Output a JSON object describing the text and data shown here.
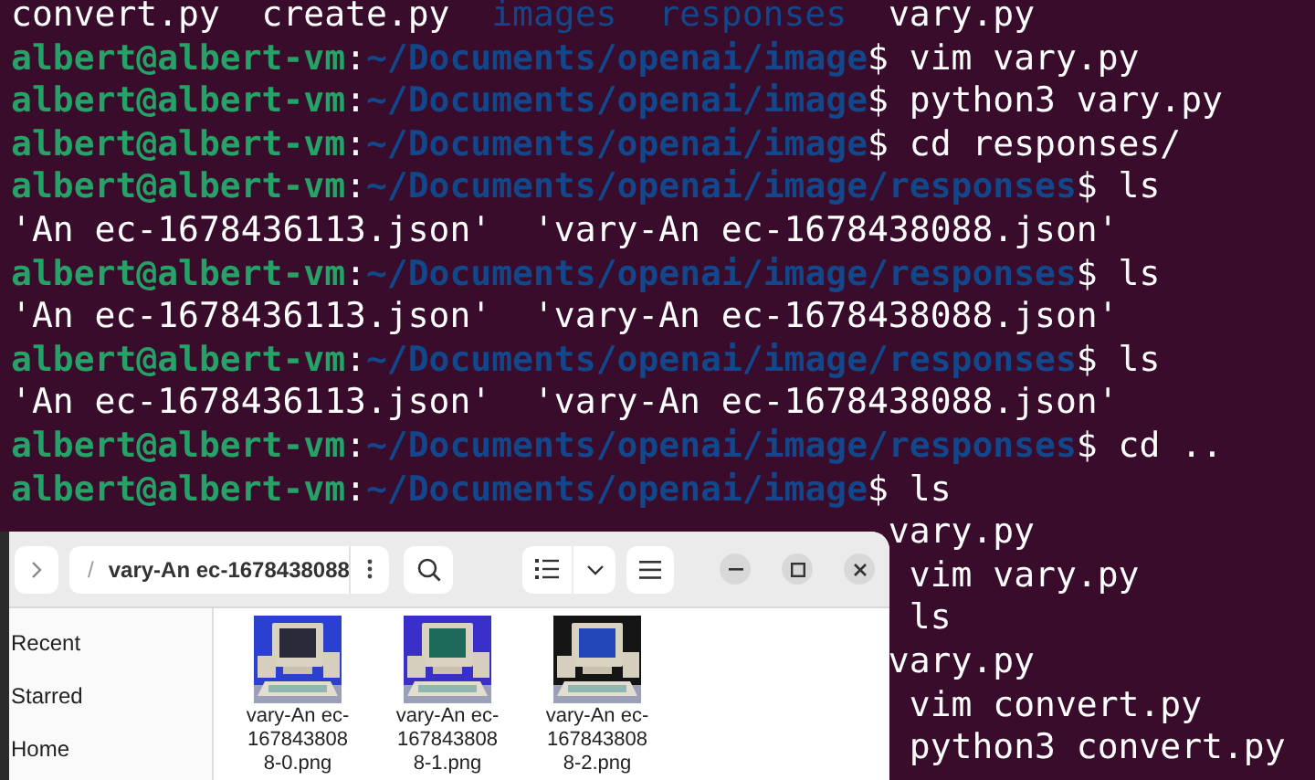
{
  "terminal": {
    "lines": [
      {
        "parts": [
          {
            "kind": "plain",
            "text": "convert.py  create.py"
          },
          {
            "kind": "dir",
            "text": "  images"
          },
          {
            "kind": "dir",
            "text": "  responses"
          },
          {
            "kind": "plain",
            "text": "  vary.py"
          }
        ]
      },
      {
        "parts": [
          {
            "kind": "user",
            "text": "albert@albert-vm"
          },
          {
            "kind": "plain",
            "text": ":"
          },
          {
            "kind": "path",
            "text": "~/Documents/openai/image"
          },
          {
            "kind": "plain",
            "text": "$ vim vary.py"
          }
        ]
      },
      {
        "parts": [
          {
            "kind": "user",
            "text": "albert@albert-vm"
          },
          {
            "kind": "plain",
            "text": ":"
          },
          {
            "kind": "path",
            "text": "~/Documents/openai/image"
          },
          {
            "kind": "plain",
            "text": "$ python3 vary.py"
          }
        ]
      },
      {
        "parts": [
          {
            "kind": "user",
            "text": "albert@albert-vm"
          },
          {
            "kind": "plain",
            "text": ":"
          },
          {
            "kind": "path",
            "text": "~/Documents/openai/image"
          },
          {
            "kind": "plain",
            "text": "$ cd responses/"
          }
        ]
      },
      {
        "parts": [
          {
            "kind": "user",
            "text": "albert@albert-vm"
          },
          {
            "kind": "plain",
            "text": ":"
          },
          {
            "kind": "path",
            "text": "~/Documents/openai/image/responses"
          },
          {
            "kind": "plain",
            "text": "$ ls"
          }
        ]
      },
      {
        "parts": [
          {
            "kind": "plain",
            "text": "'An ec-1678436113.json'  'vary-An ec-1678438088.json'"
          }
        ]
      },
      {
        "parts": [
          {
            "kind": "user",
            "text": "albert@albert-vm"
          },
          {
            "kind": "plain",
            "text": ":"
          },
          {
            "kind": "path",
            "text": "~/Documents/openai/image/responses"
          },
          {
            "kind": "plain",
            "text": "$ ls"
          }
        ]
      },
      {
        "parts": [
          {
            "kind": "plain",
            "text": "'An ec-1678436113.json'  'vary-An ec-1678438088.json'"
          }
        ]
      },
      {
        "parts": [
          {
            "kind": "user",
            "text": "albert@albert-vm"
          },
          {
            "kind": "plain",
            "text": ":"
          },
          {
            "kind": "path",
            "text": "~/Documents/openai/image/responses"
          },
          {
            "kind": "plain",
            "text": "$ ls"
          }
        ]
      },
      {
        "parts": [
          {
            "kind": "plain",
            "text": "'An ec-1678436113.json'  'vary-An ec-1678438088.json'"
          }
        ]
      },
      {
        "parts": [
          {
            "kind": "user",
            "text": "albert@albert-vm"
          },
          {
            "kind": "plain",
            "text": ":"
          },
          {
            "kind": "path",
            "text": "~/Documents/openai/image/responses"
          },
          {
            "kind": "plain",
            "text": "$ cd .."
          }
        ]
      },
      {
        "parts": [
          {
            "kind": "user",
            "text": "albert@albert-vm"
          },
          {
            "kind": "plain",
            "text": ":"
          },
          {
            "kind": "path",
            "text": "~/Documents/openai/image"
          },
          {
            "kind": "plain",
            "text": "$ ls"
          }
        ]
      }
    ],
    "hidden_tails": [
      {
        "kind": "output",
        "text": "vary.py"
      },
      {
        "kind": "command",
        "text": "vim vary.py"
      },
      {
        "kind": "command",
        "text": "ls"
      },
      {
        "kind": "output",
        "text": "vary.py"
      },
      {
        "kind": "command",
        "text": "vim convert.py"
      },
      {
        "kind": "command",
        "text": "python3 convert.py"
      }
    ]
  },
  "file_window": {
    "path": {
      "separator": "/",
      "folder": "vary-An ec-1678438088"
    },
    "sidebar": [
      {
        "label": "Recent"
      },
      {
        "label": "Starred"
      },
      {
        "label": "Home"
      }
    ],
    "files": [
      {
        "name": "vary-An ec-1678438088-0.png",
        "kind": "picture"
      },
      {
        "name": "vary-An ec-1678438088-1.png",
        "kind": "picture"
      },
      {
        "name": "vary-An ec-1678438088-2.png",
        "kind": "picture"
      }
    ]
  }
}
